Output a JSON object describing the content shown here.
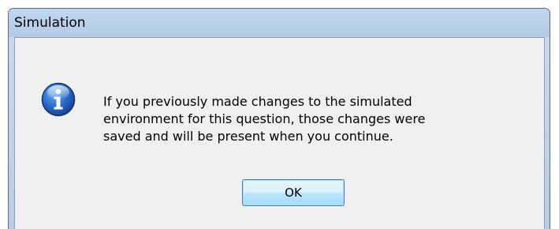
{
  "window": {
    "title": "Simulation"
  },
  "message": {
    "icon": "info-icon",
    "lines": [
      "If you previously made changes to the simulated",
      "environment for this question, those changes were",
      "saved and will be present when you continue."
    ]
  },
  "buttons": {
    "ok_label": "OK"
  },
  "colors": {
    "accent": "#1f5fb8",
    "button_border": "#3c7fb1"
  }
}
